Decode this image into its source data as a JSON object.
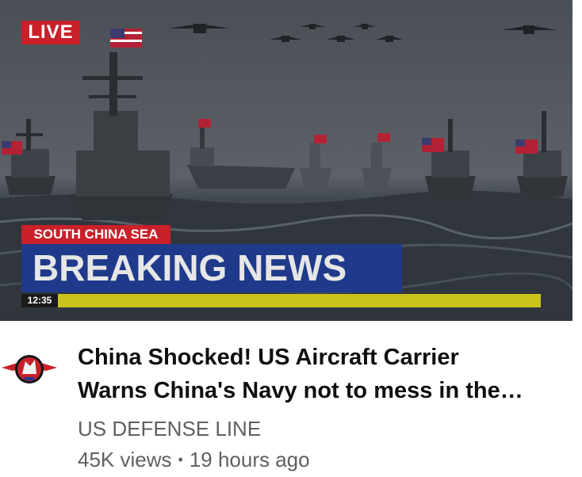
{
  "thumbnail": {
    "live_label": "LIVE",
    "location": "SOUTH CHINA SEA",
    "headline": "BREAKING NEWS",
    "ticker_time": "12:35"
  },
  "video": {
    "title_line1": "China Shocked! US Aircraft Carrier",
    "title_line2": "Warns China's Navy not to mess in the…",
    "channel": "US DEFENSE LINE",
    "views": "45K views",
    "separator": "•",
    "age": "19 hours ago"
  },
  "icons": {
    "avatar": "eagle-logo-icon",
    "menu": "none"
  },
  "colors": {
    "badge_red": "#c9202a",
    "headline_blue": "#1f3a8a",
    "ticker_yellow": "#c9c31c",
    "title_text": "#0f0f0f",
    "meta_text": "#606060"
  }
}
